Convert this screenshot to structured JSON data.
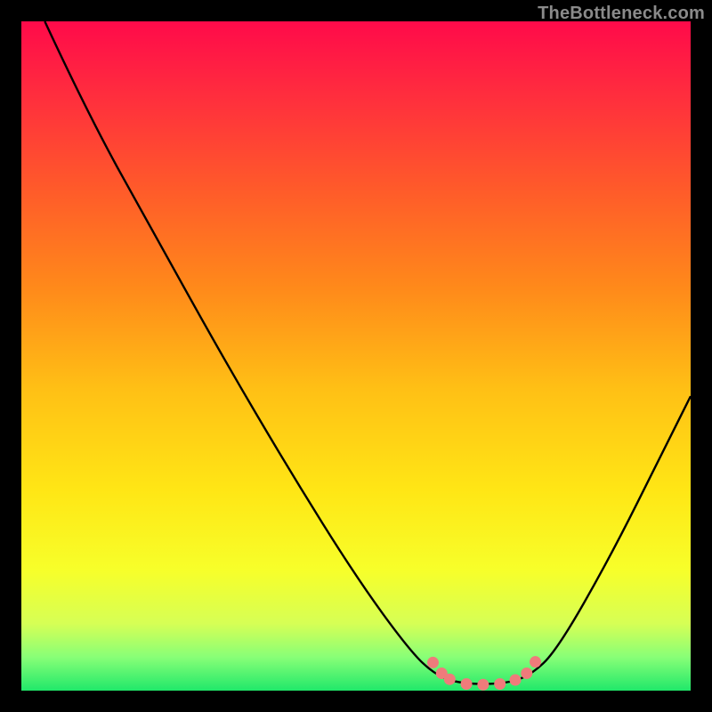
{
  "attribution": "TheBottleneck.com",
  "chart_data": {
    "type": "line",
    "title": "",
    "xlabel": "",
    "ylabel": "",
    "xlim": [
      0,
      100
    ],
    "ylim": [
      0,
      100
    ],
    "background_gradient": {
      "stops": [
        {
          "offset": 0.0,
          "color": "#ff0a4a"
        },
        {
          "offset": 0.1,
          "color": "#ff2a3f"
        },
        {
          "offset": 0.25,
          "color": "#ff5a2a"
        },
        {
          "offset": 0.4,
          "color": "#ff8a1a"
        },
        {
          "offset": 0.55,
          "color": "#ffc015"
        },
        {
          "offset": 0.7,
          "color": "#ffe615"
        },
        {
          "offset": 0.82,
          "color": "#f7ff2a"
        },
        {
          "offset": 0.9,
          "color": "#d6ff55"
        },
        {
          "offset": 0.95,
          "color": "#88ff77"
        },
        {
          "offset": 1.0,
          "color": "#20e86a"
        }
      ]
    },
    "series": [
      {
        "name": "bottleneck-curve",
        "color": "#000000",
        "width": 2.4,
        "points": [
          {
            "x": 3.5,
            "y": 100.0
          },
          {
            "x": 10.0,
            "y": 86.0
          },
          {
            "x": 20.0,
            "y": 68.0
          },
          {
            "x": 30.0,
            "y": 50.0
          },
          {
            "x": 40.0,
            "y": 33.0
          },
          {
            "x": 50.0,
            "y": 17.0
          },
          {
            "x": 58.0,
            "y": 6.0
          },
          {
            "x": 62.0,
            "y": 2.2
          },
          {
            "x": 66.0,
            "y": 1.0
          },
          {
            "x": 72.0,
            "y": 1.0
          },
          {
            "x": 76.0,
            "y": 2.2
          },
          {
            "x": 80.0,
            "y": 6.0
          },
          {
            "x": 88.0,
            "y": 20.0
          },
          {
            "x": 96.0,
            "y": 36.0
          },
          {
            "x": 100.0,
            "y": 44.0
          }
        ]
      }
    ],
    "markers": {
      "name": "highlight-dots",
      "color": "#ef7b7b",
      "radius": 6.5,
      "points": [
        {
          "x": 61.5,
          "y": 4.2
        },
        {
          "x": 62.8,
          "y": 2.6
        },
        {
          "x": 64.0,
          "y": 1.7
        },
        {
          "x": 66.5,
          "y": 1.0
        },
        {
          "x": 69.0,
          "y": 0.9
        },
        {
          "x": 71.5,
          "y": 1.0
        },
        {
          "x": 73.8,
          "y": 1.6
        },
        {
          "x": 75.5,
          "y": 2.6
        },
        {
          "x": 76.8,
          "y": 4.3
        }
      ]
    }
  }
}
